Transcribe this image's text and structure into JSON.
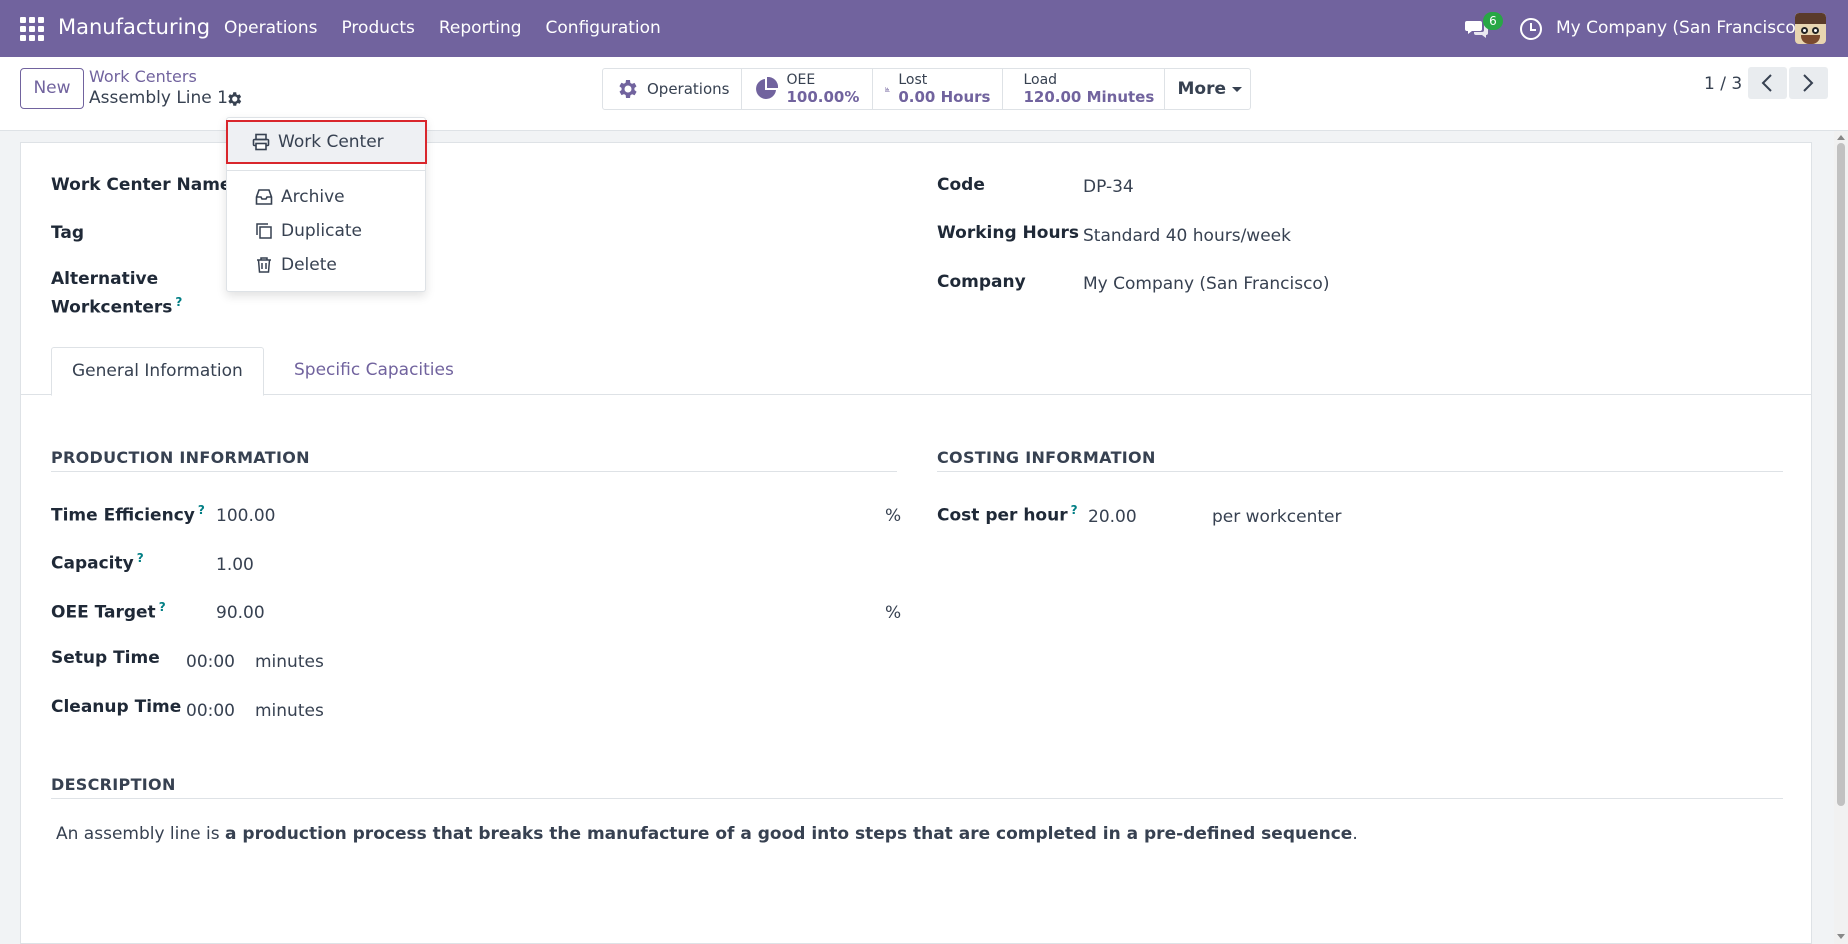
{
  "topbar": {
    "app_name": "Manufacturing",
    "menu": [
      "Operations",
      "Products",
      "Reporting",
      "Configuration"
    ],
    "chat_count": "6",
    "company": "My Company (San Francisco)"
  },
  "control": {
    "new_label": "New",
    "breadcrumb_parent": "Work Centers",
    "breadcrumb_current": "Assembly Line 1",
    "smart_buttons": {
      "operations": "Operations",
      "oee_label": "OEE",
      "oee_value": "100.00%",
      "lost_label": "Lost",
      "lost_value": "0.00 Hours",
      "load_label": "Load",
      "load_value": "120.00 Minutes",
      "more": "More"
    },
    "pager": "1 / 3"
  },
  "dropdown": {
    "items": [
      "Work Center",
      "Archive",
      "Duplicate",
      "Delete"
    ]
  },
  "form": {
    "work_center_name_label": "Work Center Name",
    "tag_label": "Tag",
    "alt_workcenters_label_1": "Alternative",
    "alt_workcenters_label_2": "Workcenters",
    "code_label": "Code",
    "code_value": "DP-34",
    "working_hours_label": "Working Hours",
    "working_hours_value": "Standard 40 hours/week",
    "company_label": "Company",
    "company_value": "My Company (San Francisco)",
    "help_mark": "?"
  },
  "tabs": [
    "General Information",
    "Specific Capacities"
  ],
  "production": {
    "title": "PRODUCTION INFORMATION",
    "time_efficiency_label": "Time Efficiency",
    "time_efficiency_value": "100.00",
    "capacity_label": "Capacity",
    "capacity_value": "1.00",
    "oee_target_label": "OEE Target",
    "oee_target_value": "90.00",
    "percent": "%",
    "setup_time_label": "Setup Time",
    "setup_time_value": "00:00",
    "cleanup_time_label": "Cleanup Time",
    "cleanup_time_value": "00:00",
    "minutes": "minutes"
  },
  "costing": {
    "title": "COSTING INFORMATION",
    "cost_per_hour_label": "Cost per hour",
    "cost_per_hour_value": "20.00",
    "per_workcenter": "per workcenter"
  },
  "description": {
    "title": "DESCRIPTION",
    "text_prefix": "An assembly line is ",
    "text_bold": "a production process that breaks the manufacture of a good into steps that are completed in a pre-defined sequence",
    "text_suffix": "."
  },
  "colors": {
    "brand": "#71639e",
    "highlight_border": "#d9262c",
    "badge": "#28a745",
    "help": "#017e84"
  }
}
